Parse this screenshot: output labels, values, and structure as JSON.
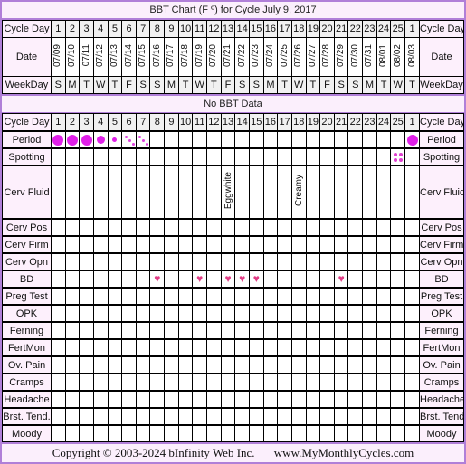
{
  "title": "BBT Chart (F º) for Cycle July 9, 2017",
  "header": {
    "cycle_day_label": "Cycle Day",
    "date_label": "Date",
    "weekday_label": "WeekDay",
    "cycle_days": [
      "1",
      "2",
      "3",
      "4",
      "5",
      "6",
      "7",
      "8",
      "9",
      "10",
      "11",
      "12",
      "13",
      "14",
      "15",
      "16",
      "17",
      "18",
      "19",
      "20",
      "21",
      "22",
      "23",
      "24",
      "25",
      "1"
    ],
    "dates": [
      "07/09",
      "07/10",
      "07/11",
      "07/12",
      "07/13",
      "07/14",
      "07/15",
      "07/16",
      "07/17",
      "07/18",
      "07/19",
      "07/20",
      "07/21",
      "07/22",
      "07/23",
      "07/24",
      "07/25",
      "07/26",
      "07/27",
      "07/28",
      "07/29",
      "07/30",
      "07/31",
      "08/01",
      "08/02",
      "08/03"
    ],
    "weekdays": [
      "S",
      "M",
      "T",
      "W",
      "T",
      "F",
      "S",
      "S",
      "M",
      "T",
      "W",
      "T",
      "F",
      "S",
      "S",
      "M",
      "T",
      "W",
      "T",
      "F",
      "S",
      "S",
      "M",
      "T",
      "W",
      "T"
    ]
  },
  "bbt_banner": "No BBT Data",
  "rows": [
    {
      "key": "period",
      "label": "Period",
      "marks": {
        "0": "heavy",
        "1": "heavy",
        "2": "heavy",
        "3": "medium",
        "4": "light",
        "5": "spotting",
        "6": "spotting",
        "25": "heavy"
      }
    },
    {
      "key": "spotting",
      "label": "Spotting",
      "marks": {
        "24": "spot"
      }
    },
    {
      "key": "cerv-fluid",
      "label": "Cerv Fluid",
      "marks": {
        "12": "Eggwhite",
        "17": "Creamy"
      }
    },
    {
      "key": "cerv-pos",
      "label": "Cerv Pos",
      "marks": {}
    },
    {
      "key": "cerv-firm",
      "label": "Cerv Firm",
      "marks": {}
    },
    {
      "key": "cerv-opn",
      "label": "Cerv Opn",
      "marks": {}
    },
    {
      "key": "bd",
      "label": "BD",
      "marks": {
        "7": "heart",
        "10": "heart",
        "12": "heart",
        "13": "heart",
        "14": "heart",
        "20": "heart"
      }
    },
    {
      "key": "preg-test",
      "label": "Preg Test",
      "marks": {}
    },
    {
      "key": "opk",
      "label": "OPK",
      "marks": {}
    },
    {
      "key": "ferning",
      "label": "Ferning",
      "marks": {}
    },
    {
      "key": "fertmon",
      "label": "FertMon",
      "marks": {}
    },
    {
      "key": "ov-pain",
      "label": "Ov. Pain",
      "marks": {}
    },
    {
      "key": "cramps",
      "label": "Cramps",
      "marks": {}
    },
    {
      "key": "headache",
      "label": "Headache",
      "marks": {}
    },
    {
      "key": "brst-tend",
      "label": "Brst. Tend.",
      "marks": {}
    },
    {
      "key": "moody",
      "label": "Moody",
      "marks": {}
    }
  ],
  "icons": {
    "heart": "♥",
    "period_color": "#e020e8",
    "heart_color": "#e23c86",
    "accent_border": "#b07fd8"
  },
  "footer": {
    "copyright": "Copyright © 2003-2024 bInfinity Web Inc.",
    "site": "www.MyMonthlyCycles.com"
  }
}
